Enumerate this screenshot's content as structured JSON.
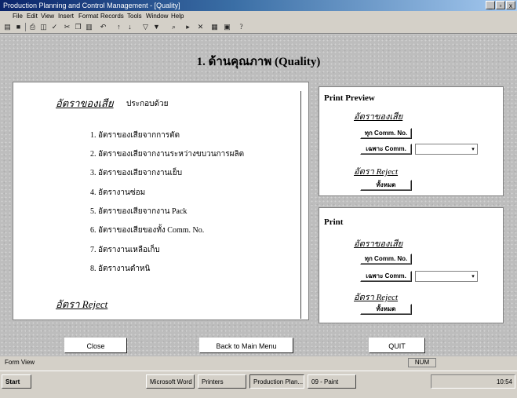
{
  "window": {
    "title": "Production Planning and Control Management - [Quality]"
  },
  "menu": [
    "File",
    "Edit",
    "View",
    "Insert",
    "Format",
    "Records",
    "Tools",
    "Window",
    "Help"
  ],
  "form": {
    "title": "1. ด้านคุณภาพ (Quality)",
    "main": {
      "heading": "อัตราของเสีย",
      "unit_label": "ประกอบด้วย",
      "items": [
        "1. อัตราของเสียจากการตัด",
        "2. อัตราของเสียจากงานระหว่างขบวนการผลิต",
        "3. อัตราของเสียจากงานเย็บ",
        "4. อัตรางานซ่อม",
        "5. อัตราของเสียจากงาน Pack",
        "6. อัตราของเสียของทั้ง Comm. No.",
        "7. อัตรางานเหลือเก็บ",
        "8. อัตรางานตำหนิ"
      ],
      "reject_heading": "อัตรา Reject"
    },
    "preview": {
      "title": "Print Preview",
      "defect_link": "อัตราของเสีย",
      "btn_all_comm": "ทุก Comm. No.",
      "btn_by_comm": "เฉพาะ Comm.",
      "reject_link": "อัตรา Reject",
      "btn_reject_all": "ทั้งหมด"
    },
    "print": {
      "title": "Print",
      "defect_link": "อัตราของเสีย",
      "btn_all_comm": "ทุก Comm. No.",
      "btn_by_comm": "เฉพาะ Comm.",
      "reject_link": "อัตรา Reject",
      "btn_reject_all": "ทั้งหมด"
    },
    "buttons": {
      "close": "Close",
      "back": "Back to Main Menu",
      "quit": "QUIT"
    }
  },
  "status": {
    "left": "Form View",
    "num": "NUM"
  },
  "taskbar": {
    "start": "Start",
    "tasks": [
      "Microsoft Word",
      "Printers",
      "Production Plan...",
      "09 - Paint"
    ],
    "clock": "10:54"
  }
}
